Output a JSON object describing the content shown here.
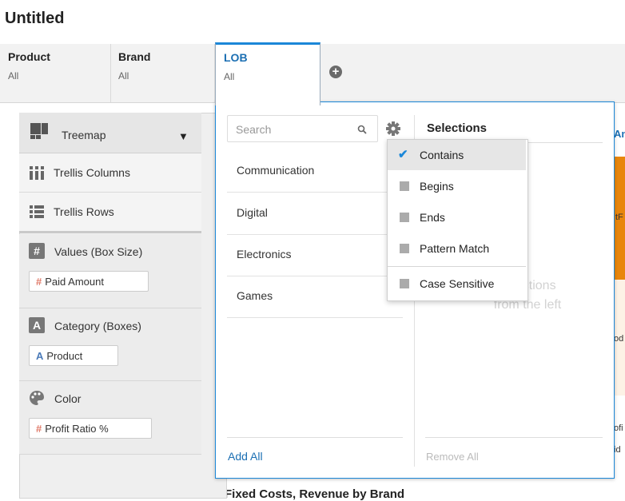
{
  "title": "Untitled",
  "filters": [
    {
      "label": "Product",
      "value": "All"
    },
    {
      "label": "Brand",
      "value": "All"
    },
    {
      "label": "LOB",
      "value": "All"
    }
  ],
  "add_filter_icon": "plus-circle-icon",
  "viz": {
    "label": "Treemap",
    "icon": "treemap-icon"
  },
  "trellis": [
    {
      "label": "Trellis Columns",
      "icon": "trellis-columns-icon"
    },
    {
      "label": "Trellis Rows",
      "icon": "trellis-rows-icon"
    }
  ],
  "sections": [
    {
      "header": "Values (Box Size)",
      "pill": "Paid Amount",
      "pill_prefix": "#"
    },
    {
      "header": "Category (Boxes)",
      "pill": "Product",
      "pill_prefix": "A"
    },
    {
      "header": "Color",
      "pill": "Profit Ratio %",
      "pill_prefix": "#"
    }
  ],
  "popup": {
    "search_placeholder": "Search",
    "list": [
      "Communication",
      "Digital",
      "Electronics",
      "Games"
    ],
    "selections_title": "Selections",
    "placeholder_text": "selections\nfrom the left",
    "add_all": "Add All",
    "remove_all": "Remove All"
  },
  "menu": {
    "items": [
      {
        "label": "Contains",
        "checked": true
      },
      {
        "label": "Begins",
        "checked": false
      },
      {
        "label": "Ends",
        "checked": false
      },
      {
        "label": "Pattern Match",
        "checked": false
      }
    ],
    "extra": {
      "label": "Case Sensitive",
      "checked": false
    }
  },
  "background": {
    "partial_texts": [
      "An",
      "tF",
      "od",
      "ofi",
      "id"
    ],
    "bottom_title": "Fixed Costs, Revenue by Brand"
  },
  "colors": {
    "accent": "#1b87d8",
    "orange": "#e8860c"
  }
}
